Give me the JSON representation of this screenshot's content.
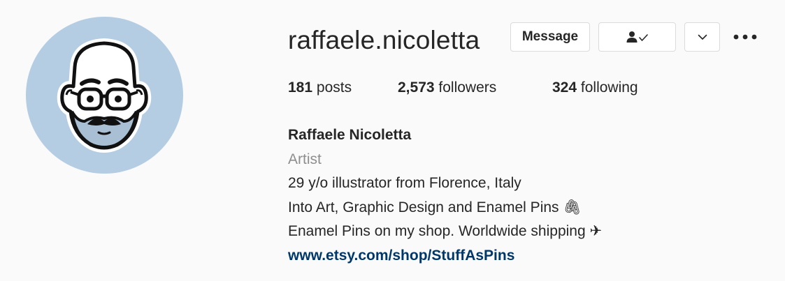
{
  "profile": {
    "username": "raffaele.nicoletta",
    "display_name": "Raffaele Nicoletta",
    "category": "Artist",
    "bio_lines": [
      "29 y/o illustrator from Florence, Italy",
      "Into Art, Graphic Design and Enamel Pins 🖇",
      "Enamel Pins on my shop. Worldwide shipping ✈"
    ],
    "link": "www.etsy.com/shop/StuffAsPins"
  },
  "actions": {
    "message_label": "Message",
    "following_icon": "person-check-icon",
    "more_icon": "chevron-down-icon",
    "options_icon": "three-dots-icon"
  },
  "stats": {
    "posts_count": "181",
    "posts_label": "posts",
    "followers_count": "2,573",
    "followers_label": "followers",
    "following_count": "324",
    "following_label": "following"
  },
  "colors": {
    "avatar_bg": "#b4cde3",
    "link": "#00376b",
    "muted": "#8e8e8e"
  }
}
